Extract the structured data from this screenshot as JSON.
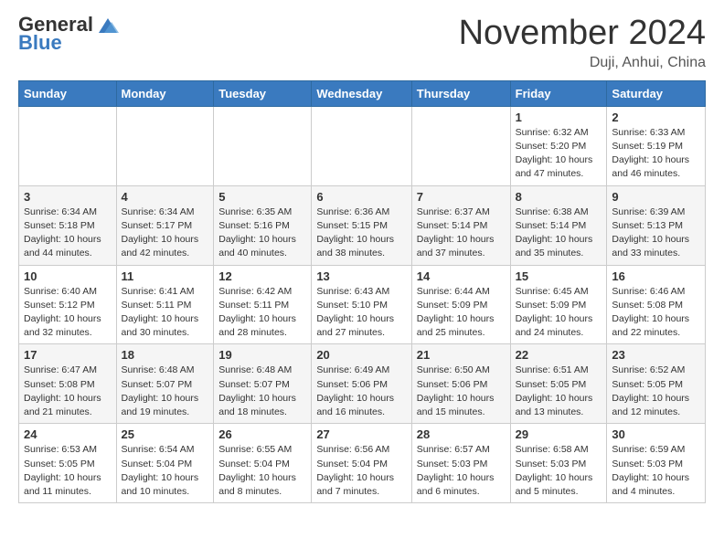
{
  "header": {
    "logo_general": "General",
    "logo_blue": "Blue",
    "month_title": "November 2024",
    "location": "Duji, Anhui, China"
  },
  "weekdays": [
    "Sunday",
    "Monday",
    "Tuesday",
    "Wednesday",
    "Thursday",
    "Friday",
    "Saturday"
  ],
  "weeks": [
    [
      {
        "day": "",
        "info": ""
      },
      {
        "day": "",
        "info": ""
      },
      {
        "day": "",
        "info": ""
      },
      {
        "day": "",
        "info": ""
      },
      {
        "day": "",
        "info": ""
      },
      {
        "day": "1",
        "info": "Sunrise: 6:32 AM\nSunset: 5:20 PM\nDaylight: 10 hours and 47 minutes."
      },
      {
        "day": "2",
        "info": "Sunrise: 6:33 AM\nSunset: 5:19 PM\nDaylight: 10 hours and 46 minutes."
      }
    ],
    [
      {
        "day": "3",
        "info": "Sunrise: 6:34 AM\nSunset: 5:18 PM\nDaylight: 10 hours and 44 minutes."
      },
      {
        "day": "4",
        "info": "Sunrise: 6:34 AM\nSunset: 5:17 PM\nDaylight: 10 hours and 42 minutes."
      },
      {
        "day": "5",
        "info": "Sunrise: 6:35 AM\nSunset: 5:16 PM\nDaylight: 10 hours and 40 minutes."
      },
      {
        "day": "6",
        "info": "Sunrise: 6:36 AM\nSunset: 5:15 PM\nDaylight: 10 hours and 38 minutes."
      },
      {
        "day": "7",
        "info": "Sunrise: 6:37 AM\nSunset: 5:14 PM\nDaylight: 10 hours and 37 minutes."
      },
      {
        "day": "8",
        "info": "Sunrise: 6:38 AM\nSunset: 5:14 PM\nDaylight: 10 hours and 35 minutes."
      },
      {
        "day": "9",
        "info": "Sunrise: 6:39 AM\nSunset: 5:13 PM\nDaylight: 10 hours and 33 minutes."
      }
    ],
    [
      {
        "day": "10",
        "info": "Sunrise: 6:40 AM\nSunset: 5:12 PM\nDaylight: 10 hours and 32 minutes."
      },
      {
        "day": "11",
        "info": "Sunrise: 6:41 AM\nSunset: 5:11 PM\nDaylight: 10 hours and 30 minutes."
      },
      {
        "day": "12",
        "info": "Sunrise: 6:42 AM\nSunset: 5:11 PM\nDaylight: 10 hours and 28 minutes."
      },
      {
        "day": "13",
        "info": "Sunrise: 6:43 AM\nSunset: 5:10 PM\nDaylight: 10 hours and 27 minutes."
      },
      {
        "day": "14",
        "info": "Sunrise: 6:44 AM\nSunset: 5:09 PM\nDaylight: 10 hours and 25 minutes."
      },
      {
        "day": "15",
        "info": "Sunrise: 6:45 AM\nSunset: 5:09 PM\nDaylight: 10 hours and 24 minutes."
      },
      {
        "day": "16",
        "info": "Sunrise: 6:46 AM\nSunset: 5:08 PM\nDaylight: 10 hours and 22 minutes."
      }
    ],
    [
      {
        "day": "17",
        "info": "Sunrise: 6:47 AM\nSunset: 5:08 PM\nDaylight: 10 hours and 21 minutes."
      },
      {
        "day": "18",
        "info": "Sunrise: 6:48 AM\nSunset: 5:07 PM\nDaylight: 10 hours and 19 minutes."
      },
      {
        "day": "19",
        "info": "Sunrise: 6:48 AM\nSunset: 5:07 PM\nDaylight: 10 hours and 18 minutes."
      },
      {
        "day": "20",
        "info": "Sunrise: 6:49 AM\nSunset: 5:06 PM\nDaylight: 10 hours and 16 minutes."
      },
      {
        "day": "21",
        "info": "Sunrise: 6:50 AM\nSunset: 5:06 PM\nDaylight: 10 hours and 15 minutes."
      },
      {
        "day": "22",
        "info": "Sunrise: 6:51 AM\nSunset: 5:05 PM\nDaylight: 10 hours and 13 minutes."
      },
      {
        "day": "23",
        "info": "Sunrise: 6:52 AM\nSunset: 5:05 PM\nDaylight: 10 hours and 12 minutes."
      }
    ],
    [
      {
        "day": "24",
        "info": "Sunrise: 6:53 AM\nSunset: 5:05 PM\nDaylight: 10 hours and 11 minutes."
      },
      {
        "day": "25",
        "info": "Sunrise: 6:54 AM\nSunset: 5:04 PM\nDaylight: 10 hours and 10 minutes."
      },
      {
        "day": "26",
        "info": "Sunrise: 6:55 AM\nSunset: 5:04 PM\nDaylight: 10 hours and 8 minutes."
      },
      {
        "day": "27",
        "info": "Sunrise: 6:56 AM\nSunset: 5:04 PM\nDaylight: 10 hours and 7 minutes."
      },
      {
        "day": "28",
        "info": "Sunrise: 6:57 AM\nSunset: 5:03 PM\nDaylight: 10 hours and 6 minutes."
      },
      {
        "day": "29",
        "info": "Sunrise: 6:58 AM\nSunset: 5:03 PM\nDaylight: 10 hours and 5 minutes."
      },
      {
        "day": "30",
        "info": "Sunrise: 6:59 AM\nSunset: 5:03 PM\nDaylight: 10 hours and 4 minutes."
      }
    ]
  ]
}
